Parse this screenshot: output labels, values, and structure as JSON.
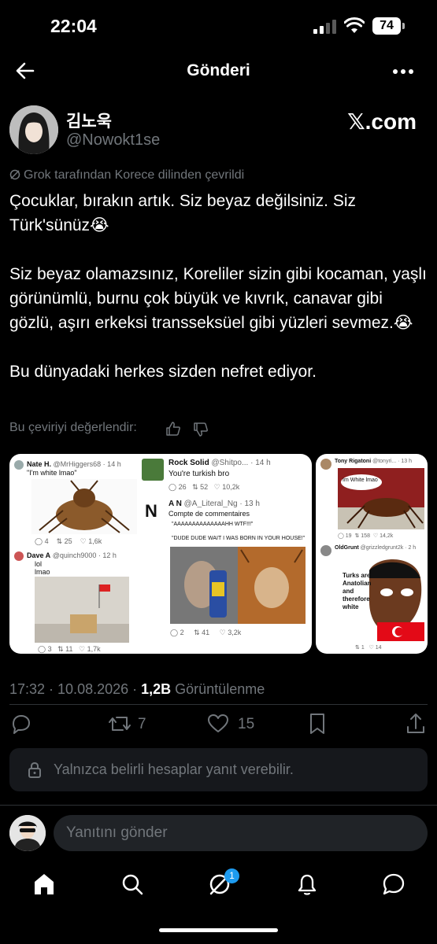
{
  "status_bar": {
    "time": "22:04",
    "battery": "74"
  },
  "header": {
    "title": "Gönderi"
  },
  "post": {
    "display_name": "김노욱",
    "handle": "@Nowokt1se",
    "watermark": "𝕏.com",
    "translation_note": "Grok tarafından Korece dilinden çevrildi",
    "paragraphs": [
      "Çocuklar, bırakın artık. Siz beyaz değilsiniz. Siz Türk'sünüz😭",
      "Siz beyaz olamazsınız, Koreliler sizin gibi kocaman, yaşlı görünümlü, burnu çok büyük ve kıvrık, canavar gibi gözlü, aşırı erkeksi transseksüel gibi yüzleri sevmez.😭",
      "Bu dünyadaki herkes sizden nefret ediyor."
    ],
    "rate_translation": "Bu çeviriyi değerlendir:",
    "timestamp": "17:32 · 10.08.2026 · ",
    "views_count": "1,2B",
    "views_label": " Görüntülenme"
  },
  "media": {
    "left": {
      "t1_name": "Nate H.",
      "t1_handle": "@MrHiggers68 · 14 h",
      "t1_text": "\"I'm white lmao\"",
      "t1_stats": [
        "4",
        "25",
        "1,6k"
      ],
      "t2_name": "Dave A",
      "t2_handle": "@quinch9000 · 12 h",
      "t2_text1": "lol",
      "t2_text2": "lmao",
      "t2_stats": [
        "3",
        "11",
        "1,7k"
      ],
      "t3_name": "Rock Solid",
      "t3_handle": "@Shitpo... · 14 h",
      "t3_text": "You're turkish bro",
      "t3_stats": [
        "26",
        "52",
        "10,2k"
      ],
      "t4_name": "A N",
      "t4_handle": "@A_Literal_Ng · 13 h",
      "t4_sub": "Compte de commentaires",
      "t4_text1": "\"AAAAAAAAAAAAAAHH WTF!!!\"",
      "t4_text2": "\"DUDE DUDE WAIT I WAS BORN IN YOUR HOUSE!\"",
      "t4_stats": [
        "2",
        "41",
        "3,2k"
      ]
    },
    "right": {
      "t1_name": "Tony Rigatoni",
      "t1_handle": "@tonyri... · 13 h",
      "t1_bubble": "Im White lmao",
      "t1_stats": [
        "19",
        "158",
        "14,2k"
      ],
      "t2_name": "OldGrunt",
      "t2_handle": "@grizzledgrunt2k · 2 h",
      "t2_bubble": "Turks are Anatolian and therefore white",
      "t2_stats": [
        "1",
        "14"
      ]
    }
  },
  "engagement": {
    "retweets": "7",
    "likes": "15"
  },
  "reply_restriction": "Yalnızca belirli hesaplar yanıt verebilir.",
  "compose": {
    "placeholder": "Yanıtını gönder"
  },
  "tabbar": {
    "messages_badge": "1"
  },
  "colors": {
    "background": "#000000",
    "text": "#e7e9ea",
    "muted": "#71767b",
    "accent": "#1d9bf0"
  }
}
